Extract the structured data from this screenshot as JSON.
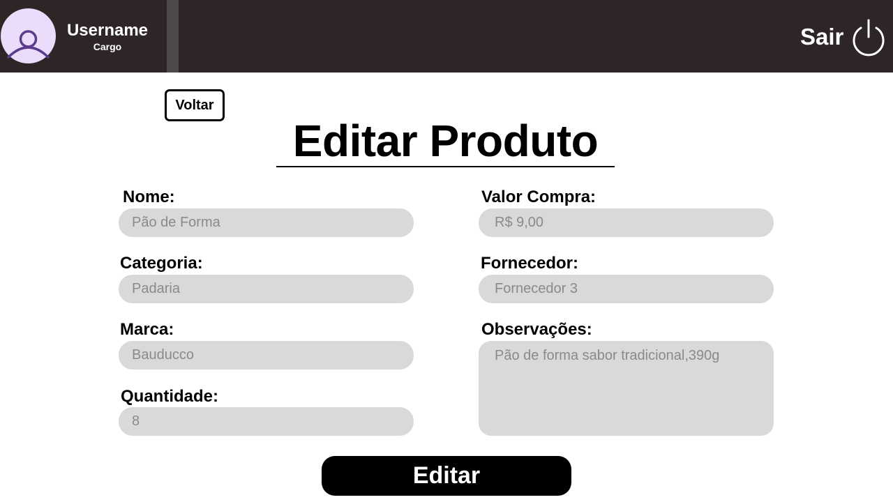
{
  "header": {
    "username": "Username",
    "role": "Cargo",
    "logout_label": "Sair",
    "avatar_icon": "user-icon",
    "logout_icon": "power-icon",
    "colors": {
      "bar": "#2e2626",
      "avatar_bg": "#ecdcfb",
      "avatar_fg": "#5a3b8c"
    }
  },
  "back_label": "Voltar",
  "title": "Editar Produto",
  "form": {
    "nome": {
      "label": "Nome:",
      "value": "Pão de Forma"
    },
    "categoria": {
      "label": "Categoria:",
      "value": "Padaria"
    },
    "marca": {
      "label": "Marca:",
      "value": "Bauducco"
    },
    "quantidade": {
      "label": "Quantidade:",
      "value": "8"
    },
    "valor_compra": {
      "label": "Valor Compra:",
      "value": "R$ 9,00"
    },
    "fornecedor": {
      "label": "Fornecedor:",
      "value": "Fornecedor 3"
    },
    "observacoes": {
      "label": "Observações:",
      "value": "Pão de forma sabor tradicional,390g"
    }
  },
  "submit_label": "Editar"
}
